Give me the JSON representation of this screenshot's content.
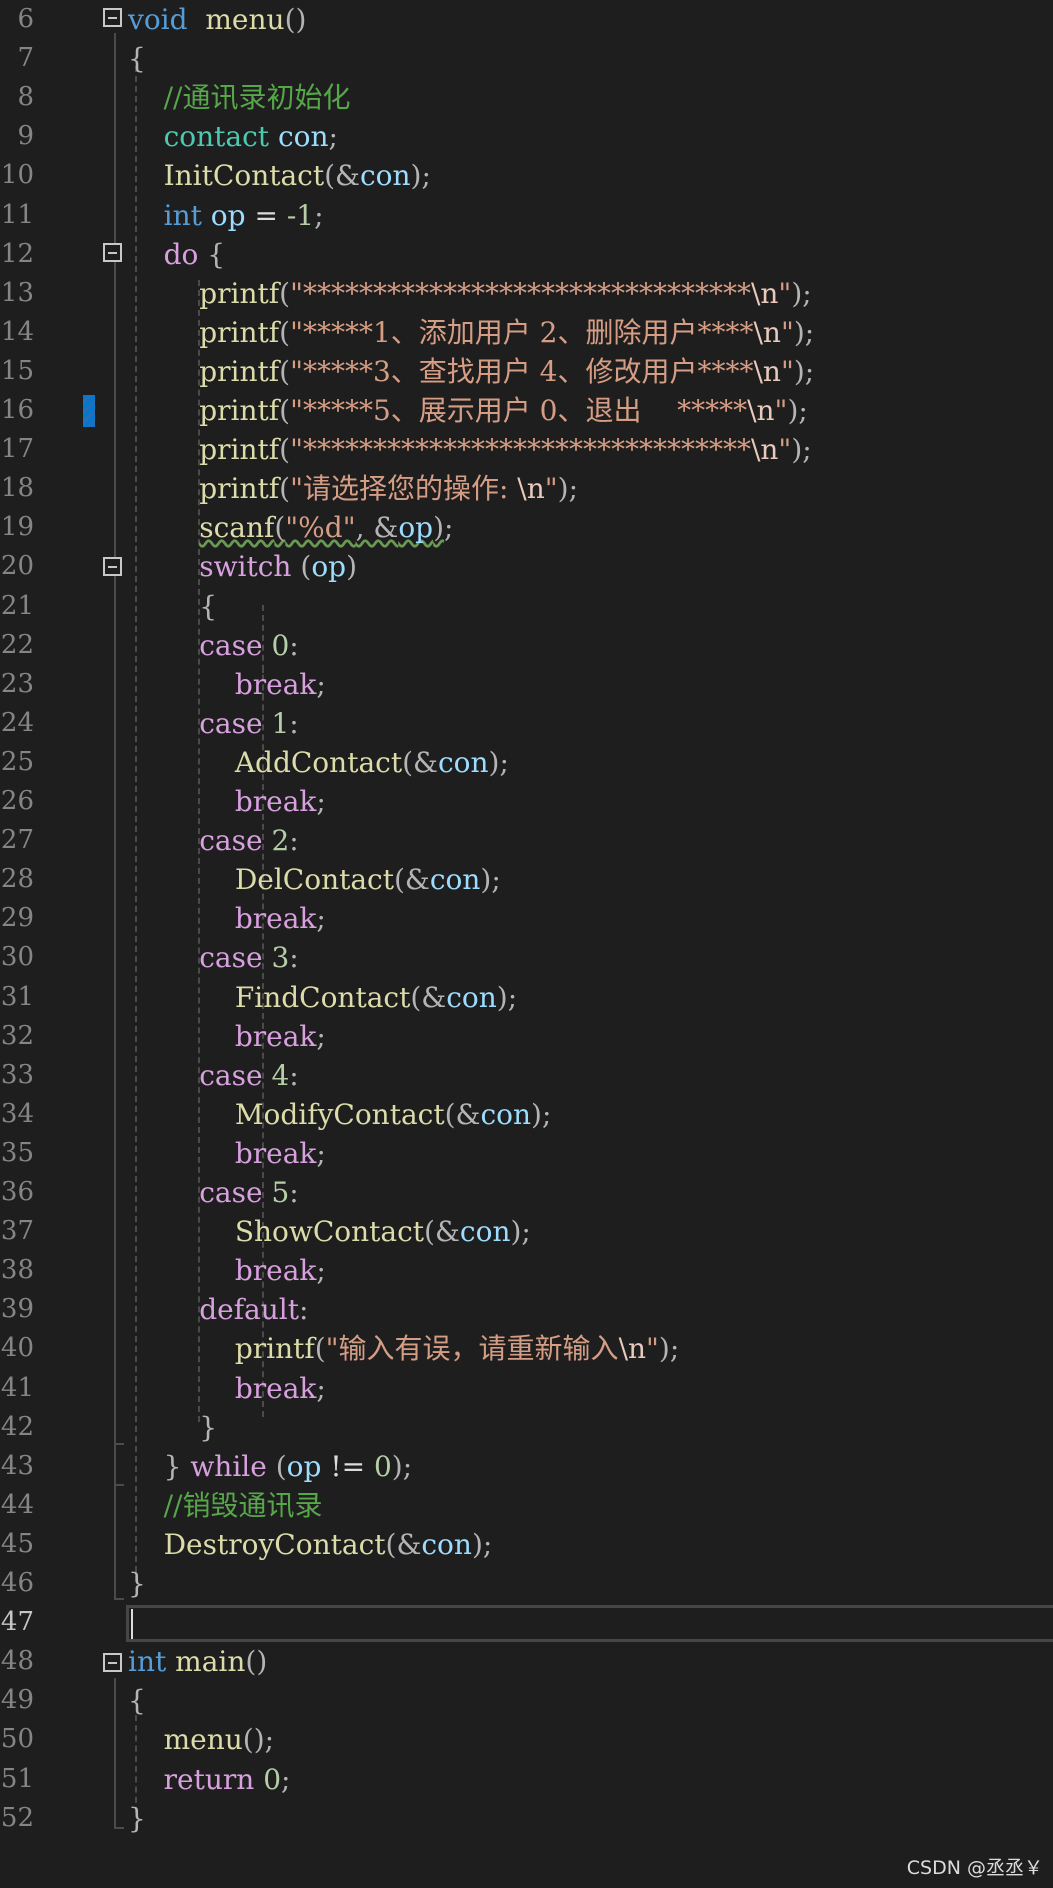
{
  "editor": {
    "current_line": 47,
    "lines": [
      {
        "n": 6,
        "tokens": [
          [
            "kw",
            "void"
          ],
          [
            "",
            "  "
          ],
          [
            "fn",
            "menu"
          ],
          [
            "punct",
            "()"
          ]
        ]
      },
      {
        "n": 7,
        "tokens": [
          [
            "punct",
            "{"
          ]
        ]
      },
      {
        "n": 8,
        "tokens": [
          [
            "",
            "    "
          ],
          [
            "cm",
            "//通讯录初始化"
          ]
        ]
      },
      {
        "n": 9,
        "tokens": [
          [
            "",
            "    "
          ],
          [
            "type",
            "contact"
          ],
          [
            "",
            " "
          ],
          [
            "var",
            "con"
          ],
          [
            "punct",
            ";"
          ]
        ]
      },
      {
        "n": 10,
        "tokens": [
          [
            "",
            "    "
          ],
          [
            "fn",
            "InitContact"
          ],
          [
            "punct",
            "(&"
          ],
          [
            "var",
            "con"
          ],
          [
            "punct",
            ");"
          ]
        ]
      },
      {
        "n": 11,
        "tokens": [
          [
            "",
            "    "
          ],
          [
            "kw",
            "int"
          ],
          [
            "",
            " "
          ],
          [
            "var",
            "op"
          ],
          [
            "",
            " = "
          ],
          [
            "num",
            "-1"
          ],
          [
            "punct",
            ";"
          ]
        ]
      },
      {
        "n": 12,
        "tokens": [
          [
            "",
            "    "
          ],
          [
            "ctl",
            "do"
          ],
          [
            "",
            " "
          ],
          [
            "punct",
            "{"
          ]
        ]
      },
      {
        "n": 13,
        "tokens": [
          [
            "",
            "        "
          ],
          [
            "fn",
            "printf"
          ],
          [
            "punct",
            "("
          ],
          [
            "str",
            "\"********************************"
          ],
          [
            "esc",
            "\\n"
          ],
          [
            "str",
            "\""
          ],
          [
            "punct",
            ");"
          ]
        ]
      },
      {
        "n": 14,
        "tokens": [
          [
            "",
            "        "
          ],
          [
            "fn",
            "printf"
          ],
          [
            "punct",
            "("
          ],
          [
            "str",
            "\"*****1、添加用户 2、删除用户****"
          ],
          [
            "esc",
            "\\n"
          ],
          [
            "str",
            "\""
          ],
          [
            "punct",
            ");"
          ]
        ]
      },
      {
        "n": 15,
        "tokens": [
          [
            "",
            "        "
          ],
          [
            "fn",
            "printf"
          ],
          [
            "punct",
            "("
          ],
          [
            "str",
            "\"*****3、查找用户 4、修改用户****"
          ],
          [
            "esc",
            "\\n"
          ],
          [
            "str",
            "\""
          ],
          [
            "punct",
            ");"
          ]
        ]
      },
      {
        "n": 16,
        "tokens": [
          [
            "",
            "        "
          ],
          [
            "fn",
            "printf"
          ],
          [
            "punct",
            "("
          ],
          [
            "str",
            "\"*****5、展示用户 0、退出    *****"
          ],
          [
            "esc",
            "\\n"
          ],
          [
            "str",
            "\""
          ],
          [
            "punct",
            ");"
          ]
        ]
      },
      {
        "n": 17,
        "tokens": [
          [
            "",
            "        "
          ],
          [
            "fn",
            "printf"
          ],
          [
            "punct",
            "("
          ],
          [
            "str",
            "\"********************************"
          ],
          [
            "esc",
            "\\n"
          ],
          [
            "str",
            "\""
          ],
          [
            "punct",
            ");"
          ]
        ]
      },
      {
        "n": 18,
        "tokens": [
          [
            "",
            "        "
          ],
          [
            "fn",
            "printf"
          ],
          [
            "punct",
            "("
          ],
          [
            "str",
            "\"请选择您的操作: "
          ],
          [
            "esc",
            "\\n"
          ],
          [
            "str",
            "\""
          ],
          [
            "punct",
            ");"
          ]
        ]
      },
      {
        "n": 19,
        "tokens": [
          [
            "",
            "        "
          ],
          [
            "fn squiggle",
            "scanf"
          ],
          [
            "punct squiggle",
            "("
          ],
          [
            "str squiggle",
            "\"%d\""
          ],
          [
            "punct squiggle",
            ", &"
          ],
          [
            "var squiggle",
            "op"
          ],
          [
            "punct squiggle",
            ")"
          ],
          [
            "punct",
            ";"
          ]
        ]
      },
      {
        "n": 20,
        "tokens": [
          [
            "",
            "        "
          ],
          [
            "ctl",
            "switch"
          ],
          [
            "",
            " "
          ],
          [
            "punct",
            "("
          ],
          [
            "var",
            "op"
          ],
          [
            "punct",
            ")"
          ]
        ]
      },
      {
        "n": 21,
        "tokens": [
          [
            "",
            "        "
          ],
          [
            "punct",
            "{"
          ]
        ]
      },
      {
        "n": 22,
        "tokens": [
          [
            "",
            "        "
          ],
          [
            "ctl",
            "case"
          ],
          [
            "",
            " "
          ],
          [
            "num",
            "0"
          ],
          [
            "punct",
            ":"
          ]
        ]
      },
      {
        "n": 23,
        "tokens": [
          [
            "",
            "            "
          ],
          [
            "ctl",
            "break"
          ],
          [
            "punct",
            ";"
          ]
        ]
      },
      {
        "n": 24,
        "tokens": [
          [
            "",
            "        "
          ],
          [
            "ctl",
            "case"
          ],
          [
            "",
            " "
          ],
          [
            "num",
            "1"
          ],
          [
            "punct",
            ":"
          ]
        ]
      },
      {
        "n": 25,
        "tokens": [
          [
            "",
            "            "
          ],
          [
            "fn",
            "AddContact"
          ],
          [
            "punct",
            "(&"
          ],
          [
            "var",
            "con"
          ],
          [
            "punct",
            ");"
          ]
        ]
      },
      {
        "n": 26,
        "tokens": [
          [
            "",
            "            "
          ],
          [
            "ctl",
            "break"
          ],
          [
            "punct",
            ";"
          ]
        ]
      },
      {
        "n": 27,
        "tokens": [
          [
            "",
            "        "
          ],
          [
            "ctl",
            "case"
          ],
          [
            "",
            " "
          ],
          [
            "num",
            "2"
          ],
          [
            "punct",
            ":"
          ]
        ]
      },
      {
        "n": 28,
        "tokens": [
          [
            "",
            "            "
          ],
          [
            "fn",
            "DelContact"
          ],
          [
            "punct",
            "(&"
          ],
          [
            "var",
            "con"
          ],
          [
            "punct",
            ");"
          ]
        ]
      },
      {
        "n": 29,
        "tokens": [
          [
            "",
            "            "
          ],
          [
            "ctl",
            "break"
          ],
          [
            "punct",
            ";"
          ]
        ]
      },
      {
        "n": 30,
        "tokens": [
          [
            "",
            "        "
          ],
          [
            "ctl",
            "case"
          ],
          [
            "",
            " "
          ],
          [
            "num",
            "3"
          ],
          [
            "punct",
            ":"
          ]
        ]
      },
      {
        "n": 31,
        "tokens": [
          [
            "",
            "            "
          ],
          [
            "fn",
            "FindContact"
          ],
          [
            "punct",
            "(&"
          ],
          [
            "var",
            "con"
          ],
          [
            "punct",
            ");"
          ]
        ]
      },
      {
        "n": 32,
        "tokens": [
          [
            "",
            "            "
          ],
          [
            "ctl",
            "break"
          ],
          [
            "punct",
            ";"
          ]
        ]
      },
      {
        "n": 33,
        "tokens": [
          [
            "",
            "        "
          ],
          [
            "ctl",
            "case"
          ],
          [
            "",
            " "
          ],
          [
            "num",
            "4"
          ],
          [
            "punct",
            ":"
          ]
        ]
      },
      {
        "n": 34,
        "tokens": [
          [
            "",
            "            "
          ],
          [
            "fn",
            "ModifyContact"
          ],
          [
            "punct",
            "(&"
          ],
          [
            "var",
            "con"
          ],
          [
            "punct",
            ");"
          ]
        ]
      },
      {
        "n": 35,
        "tokens": [
          [
            "",
            "            "
          ],
          [
            "ctl",
            "break"
          ],
          [
            "punct",
            ";"
          ]
        ]
      },
      {
        "n": 36,
        "tokens": [
          [
            "",
            "        "
          ],
          [
            "ctl",
            "case"
          ],
          [
            "",
            " "
          ],
          [
            "num",
            "5"
          ],
          [
            "punct",
            ":"
          ]
        ]
      },
      {
        "n": 37,
        "tokens": [
          [
            "",
            "            "
          ],
          [
            "fn",
            "ShowContact"
          ],
          [
            "punct",
            "(&"
          ],
          [
            "var",
            "con"
          ],
          [
            "punct",
            ");"
          ]
        ]
      },
      {
        "n": 38,
        "tokens": [
          [
            "",
            "            "
          ],
          [
            "ctl",
            "break"
          ],
          [
            "punct",
            ";"
          ]
        ]
      },
      {
        "n": 39,
        "tokens": [
          [
            "",
            "        "
          ],
          [
            "ctl",
            "default"
          ],
          [
            "punct",
            ":"
          ]
        ]
      },
      {
        "n": 40,
        "tokens": [
          [
            "",
            "            "
          ],
          [
            "fn",
            "printf"
          ],
          [
            "punct",
            "("
          ],
          [
            "str",
            "\"输入有误，请重新输入"
          ],
          [
            "esc",
            "\\n"
          ],
          [
            "str",
            "\""
          ],
          [
            "punct",
            ");"
          ]
        ]
      },
      {
        "n": 41,
        "tokens": [
          [
            "",
            "            "
          ],
          [
            "ctl",
            "break"
          ],
          [
            "punct",
            ";"
          ]
        ]
      },
      {
        "n": 42,
        "tokens": [
          [
            "",
            "        "
          ],
          [
            "punct",
            "}"
          ]
        ]
      },
      {
        "n": 43,
        "tokens": [
          [
            "",
            "    "
          ],
          [
            "punct",
            "}"
          ],
          [
            "",
            " "
          ],
          [
            "ctl",
            "while"
          ],
          [
            "",
            " "
          ],
          [
            "punct",
            "("
          ],
          [
            "var",
            "op"
          ],
          [
            "",
            " != "
          ],
          [
            "num",
            "0"
          ],
          [
            "punct",
            ");"
          ]
        ]
      },
      {
        "n": 44,
        "tokens": [
          [
            "",
            "    "
          ],
          [
            "cm",
            "//销毁通讯录"
          ]
        ]
      },
      {
        "n": 45,
        "tokens": [
          [
            "",
            "    "
          ],
          [
            "fn",
            "DestroyContact"
          ],
          [
            "punct",
            "(&"
          ],
          [
            "var",
            "con"
          ],
          [
            "punct",
            ");"
          ]
        ]
      },
      {
        "n": 46,
        "tokens": [
          [
            "punct",
            "}"
          ]
        ]
      },
      {
        "n": 47,
        "tokens": []
      },
      {
        "n": 48,
        "tokens": [
          [
            "kw",
            "int"
          ],
          [
            "",
            " "
          ],
          [
            "fn",
            "main"
          ],
          [
            "punct",
            "()"
          ]
        ]
      },
      {
        "n": 49,
        "tokens": [
          [
            "punct",
            "{"
          ]
        ]
      },
      {
        "n": 50,
        "tokens": [
          [
            "",
            "    "
          ],
          [
            "fn",
            "menu"
          ],
          [
            "punct",
            "();"
          ]
        ]
      },
      {
        "n": 51,
        "tokens": [
          [
            "",
            "    "
          ],
          [
            "ctl",
            "return"
          ],
          [
            "",
            " "
          ],
          [
            "num",
            "0"
          ],
          [
            "punct",
            ";"
          ]
        ]
      },
      {
        "n": 52,
        "tokens": [
          [
            "punct",
            "}"
          ]
        ]
      }
    ]
  },
  "colors": {
    "background": "#1e1e1e",
    "line_number": "#858585",
    "keyword": "#569cd6",
    "control": "#d8a0df",
    "function": "#dcdcaa",
    "string": "#d69d85",
    "comment": "#57a64a",
    "variable": "#9cdcfe",
    "type": "#4ec9b0",
    "number": "#b5cea8",
    "change_marker": "#0078d4"
  },
  "fold_icons": [
    "collapse-icon-line-6",
    "collapse-icon-line-12",
    "collapse-icon-line-20",
    "collapse-icon-line-48"
  ],
  "watermark": "CSDN @丞丞￥"
}
